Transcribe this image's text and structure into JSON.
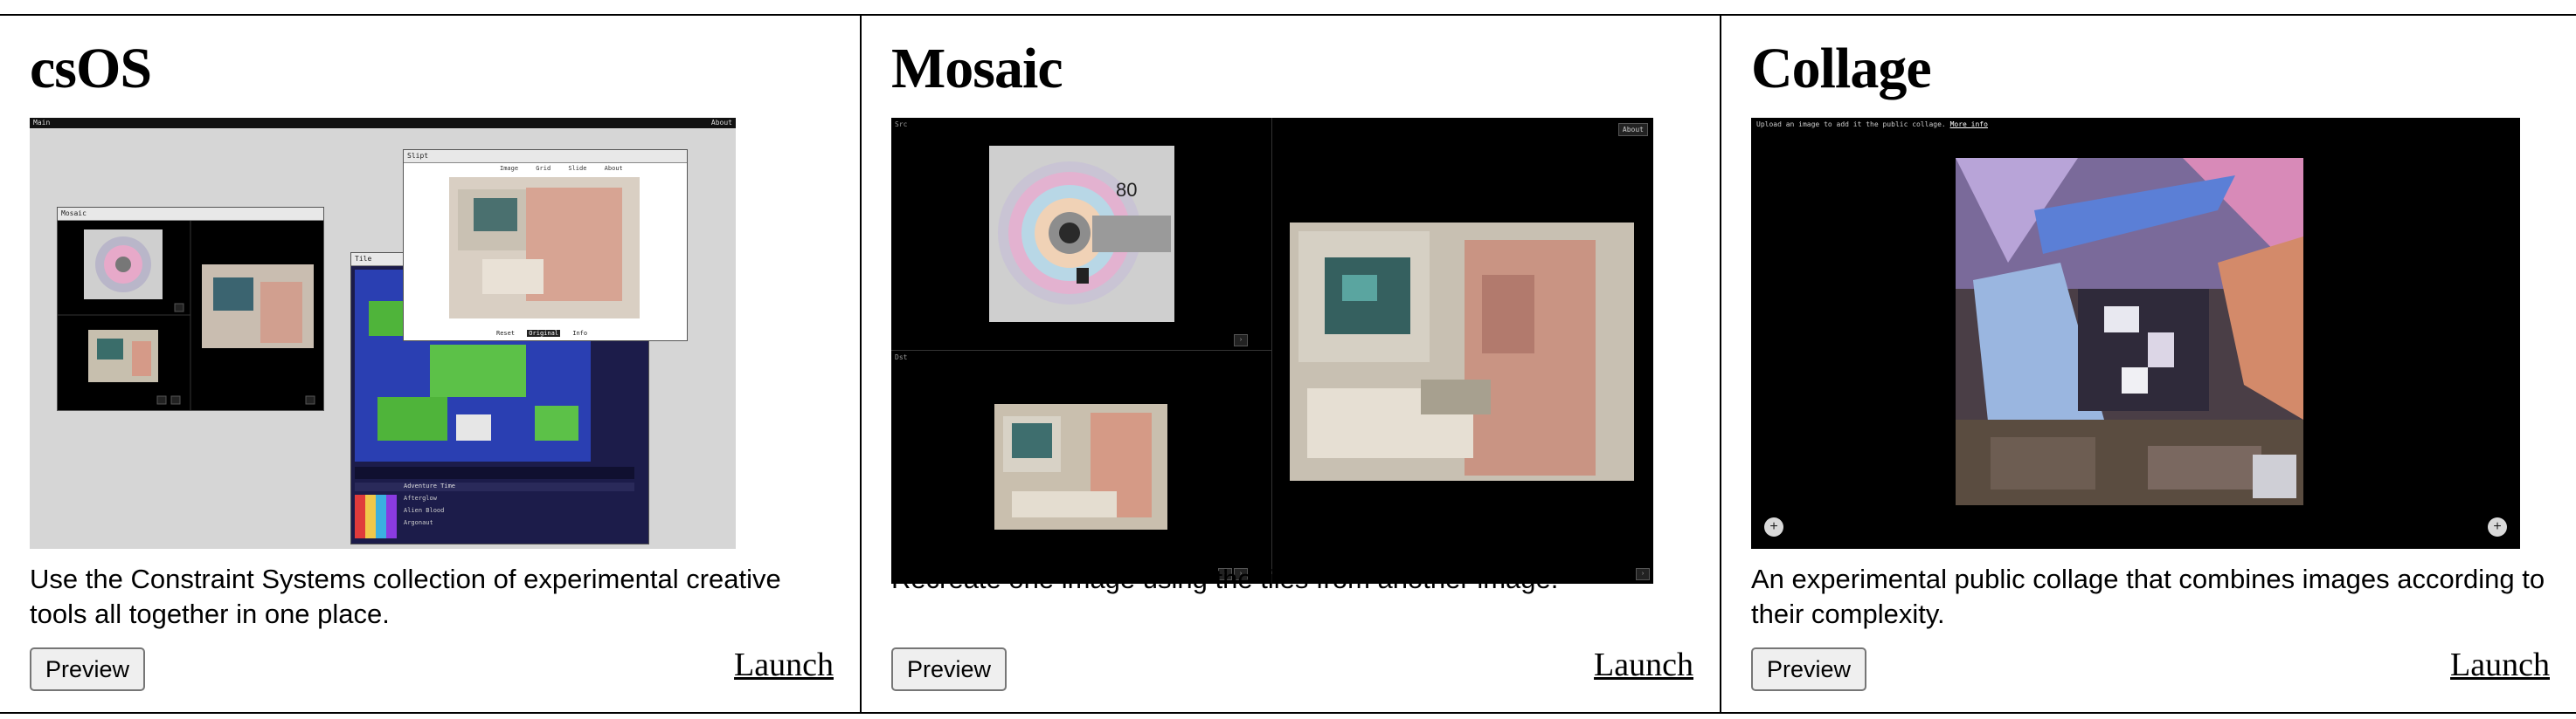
{
  "cards": [
    {
      "title": "csOS",
      "description": "Use the Constraint Systems collection of experimental creative tools all together in one place.",
      "preview_label": "Preview",
      "launch_label": "Launch",
      "screenshot": {
        "menubar_left": "Main",
        "menubar_right": "About",
        "win_mosaic_title": "Mosaic",
        "win_slipt_title": "Slipt",
        "win_slipt_menu": [
          "Image",
          "Grid",
          "Slide",
          "About"
        ],
        "win_slipt_footer": [
          "Reset",
          "Original",
          "Info"
        ],
        "win_tile_title": "Tile",
        "palette_label": "Adventure Time",
        "palette_items": [
          "Afterglow",
          "Alien Blood",
          "Argonaut"
        ],
        "colors": {
          "window_bg": "#d6d6d6"
        }
      }
    },
    {
      "title": "Mosaic",
      "description": "Recreate one image using the tiles from another image.",
      "preview_label": "Preview",
      "launch_label": "Launch",
      "screenshot": {
        "about_label": "About",
        "panel_left_top": "Src",
        "panel_left_bottom": "Dst",
        "cd_label": "80"
      }
    },
    {
      "title": "Collage",
      "description": "An experimental public collage that combines images according to their complexity.",
      "preview_label": "Preview",
      "launch_label": "Launch",
      "screenshot": {
        "upload_text": "Upload an image to add it the public collage.",
        "more_info": "More info",
        "left_button": "+",
        "right_button": "+"
      }
    }
  ]
}
